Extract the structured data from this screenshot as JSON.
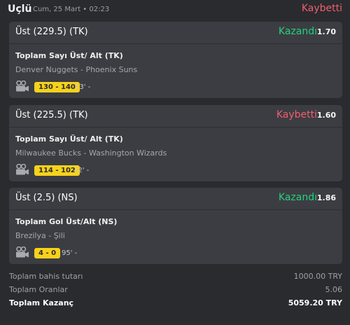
{
  "header": {
    "title": "Uçlü",
    "date": "Cum, 25 Mart • 02:23",
    "status": "Kaybetti"
  },
  "bets": [
    {
      "pick": "Üst (229.5) (TK)",
      "result": "Kazandı",
      "result_type": "win",
      "odds": "1.70",
      "market": "Toplam Sayı Üst/ Alt (TK)",
      "match": "Denver Nuggets - Phoenix Suns",
      "score": "130 - 140",
      "minute": "13' -"
    },
    {
      "pick": "Üst (225.5) (TK)",
      "result": "Kaybetti",
      "result_type": "lose",
      "odds": "1.60",
      "market": "Toplam Sayı Üst/ Alt (TK)",
      "match": "Milwaukee Bucks - Washington Wizards",
      "score": "114 - 102",
      "minute": "12' -"
    },
    {
      "pick": "Üst (2.5) (NS)",
      "result": "Kazandı",
      "result_type": "win",
      "odds": "1.86",
      "market": "Toplam Gol Üst/Alt (NS)",
      "match": "Brezilya - Şili",
      "score": "4 - 0",
      "minute": "95' -"
    }
  ],
  "summary": {
    "stake_label": "Toplam bahis tutarı",
    "stake_value": "1000.00 TRY",
    "odds_label": "Toplam Oranlar",
    "odds_value": "5.06",
    "win_label": "Toplam Kazanç",
    "win_value": "5059.20 TRY"
  },
  "colors": {
    "win": "#23d280",
    "lose": "#ef5f6e",
    "score_badge": "#f7d21b"
  },
  "icons": {
    "live_stream": "video-camera-icon"
  }
}
